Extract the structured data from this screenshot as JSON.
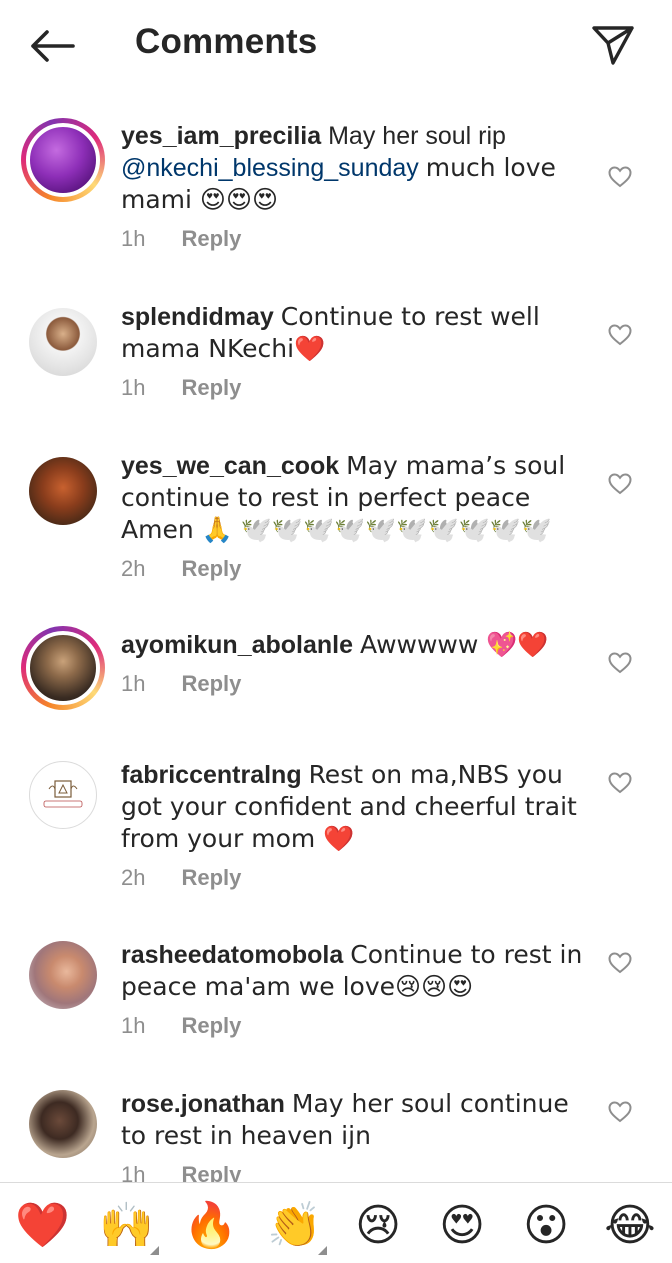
{
  "header": {
    "title": "Comments",
    "back_icon": "arrow-left-icon",
    "share_icon": "send-icon"
  },
  "comments": [
    {
      "username": "yes_iam_precilia",
      "text_before": "May her soul rip",
      "mention": "@nkechi_blessing_sunday",
      "text_after": "much love mami 😍😍😍",
      "time": "1h",
      "reply": "Reply",
      "has_story": true
    },
    {
      "username": "splendidmay",
      "text": "Continue to rest well mama NKechi❤️",
      "time": "1h",
      "reply": "Reply",
      "has_story": false
    },
    {
      "username": "yes_we_can_cook",
      "text": "May mama’s soul continue to rest in perfect peace Amen 🙏 🕊️🕊️🕊️🕊️🕊️🕊️🕊️🕊️🕊️🕊️",
      "time": "2h",
      "reply": "Reply",
      "has_story": false
    },
    {
      "username": "ayomikun_abolanle",
      "text": "Awwwww 💖❤️",
      "time": "1h",
      "reply": "Reply",
      "has_story": true
    },
    {
      "username": "fabriccentralng",
      "text": "Rest on ma,NBS you got your confident and cheerful trait from your mom ❤️",
      "time": "2h",
      "reply": "Reply",
      "has_story": false
    },
    {
      "username": "rasheedatomobola",
      "text": "Continue to rest in peace ma'am we love😢😢😍",
      "time": "1h",
      "reply": "Reply",
      "has_story": false
    },
    {
      "username": "rose.jonathan",
      "text": "May her soul continue to rest in heaven ijn",
      "time": "1h",
      "reply": "Reply",
      "has_story": false
    }
  ],
  "emoji_bar": [
    "❤️",
    "🙌",
    "🔥",
    "👏",
    "😢",
    "😍",
    "😮",
    "😂"
  ],
  "colors": {
    "text": "#262626",
    "meta": "#8e8e8e",
    "mention": "#00376b",
    "border": "#dbdbdb"
  }
}
